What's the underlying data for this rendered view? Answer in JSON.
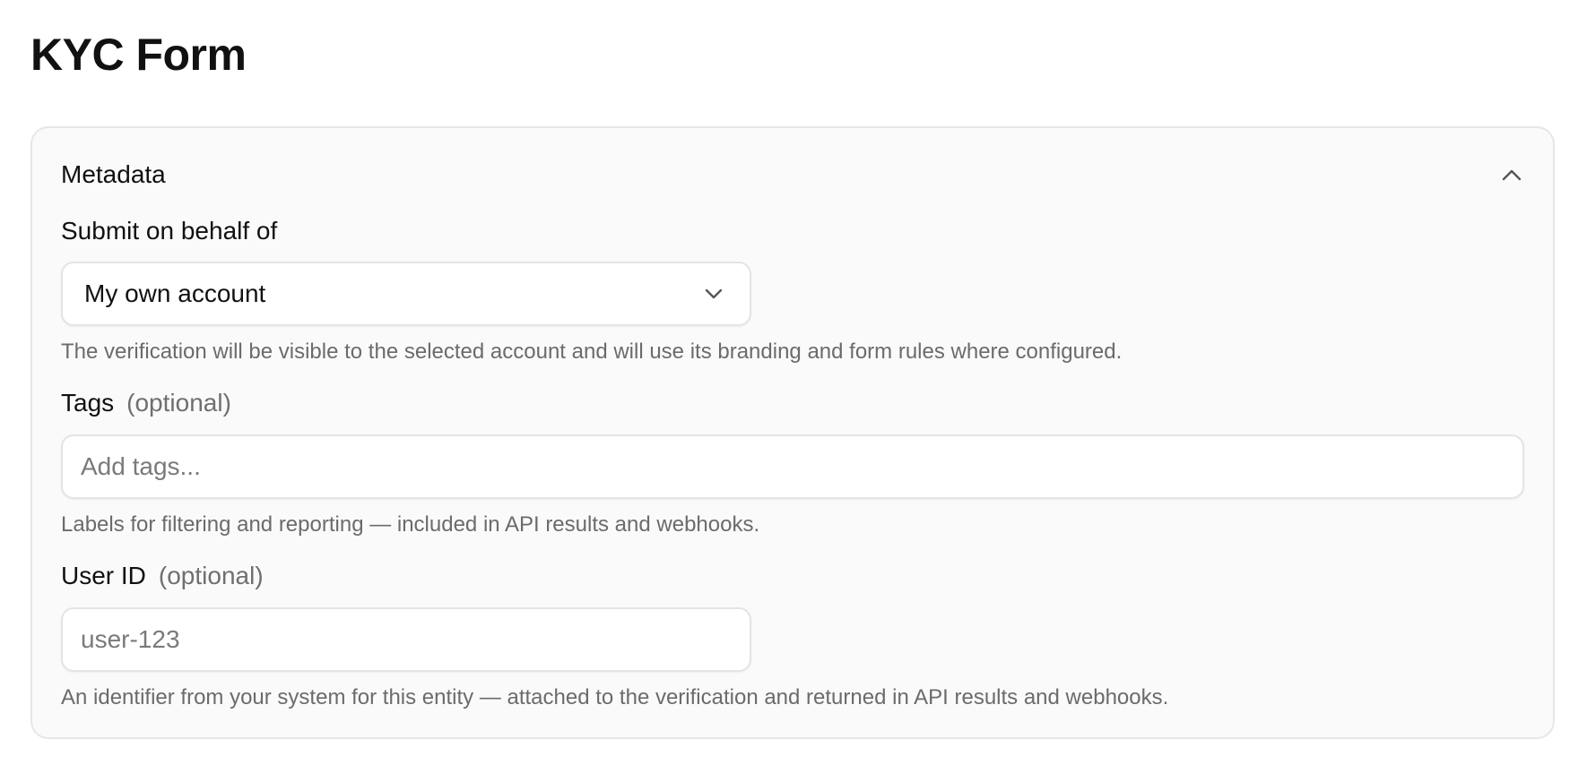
{
  "page": {
    "title": "KYC Form"
  },
  "metadata_section": {
    "title": "Metadata",
    "toggle_icon": "chevron-up-icon",
    "submit_on_behalf": {
      "label": "Submit on behalf of",
      "selected": "My own account",
      "icon": "chevron-down-icon",
      "help": "The verification will be visible to the selected account and will use its branding and form rules where configured."
    },
    "tags": {
      "label": "Tags",
      "optional": "(optional)",
      "value": "",
      "placeholder": "Add tags...",
      "help": "Labels for filtering and reporting — included in API results and webhooks."
    },
    "user_id": {
      "label": "User ID",
      "optional": "(optional)",
      "value": "",
      "placeholder": "user-123",
      "help": "An identifier from your system for this entity — attached to the verification and returned in API results and webhooks."
    }
  },
  "colors": {
    "text": "#111111",
    "muted": "#6b6b6b",
    "card_bg": "#fafafa",
    "border": "#e4e4e4"
  }
}
